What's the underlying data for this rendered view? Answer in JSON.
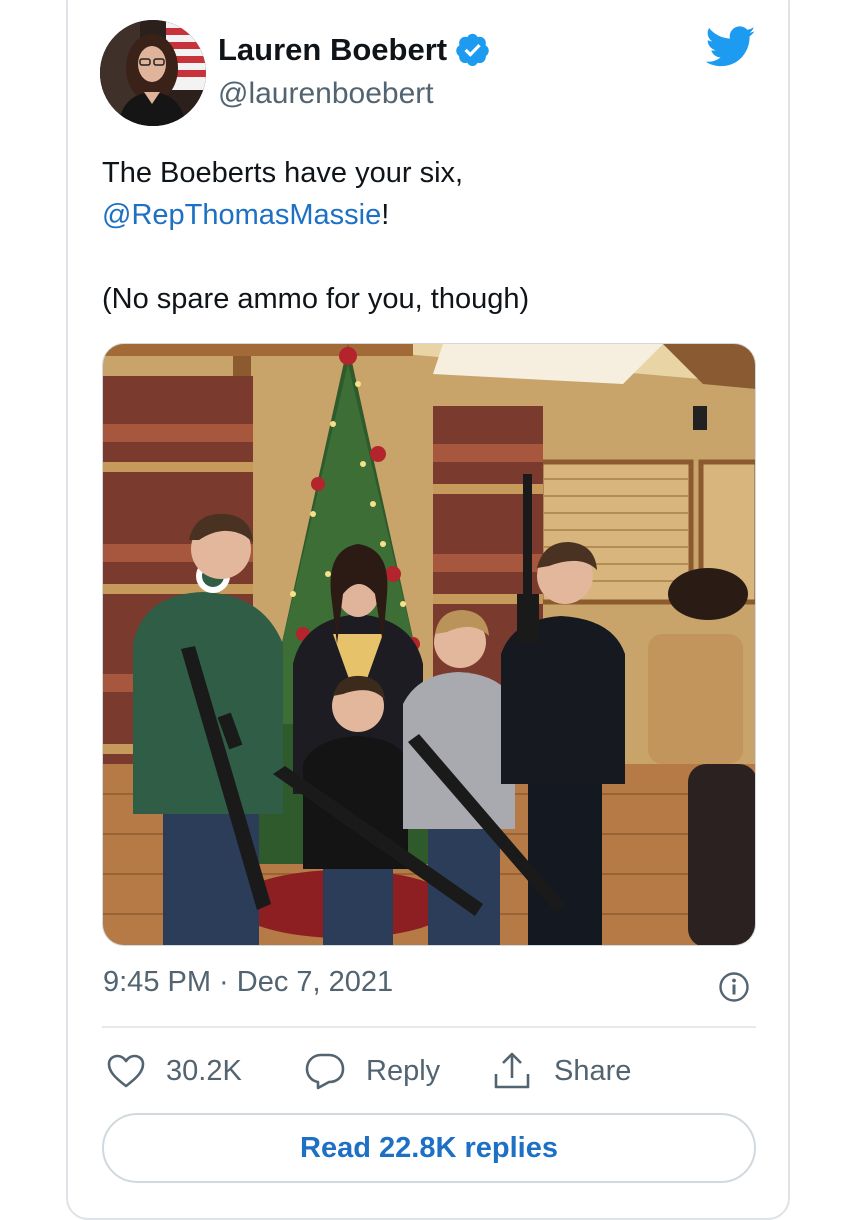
{
  "author": {
    "name": "Lauren Boebert",
    "handle": "@laurenboebert"
  },
  "tweet": {
    "line1": "The Boeberts have your six,",
    "mention": "@RepThomasMassie",
    "mention_suffix": "!",
    "line3": "(No spare ammo for you, though)"
  },
  "timestamp": "9:45 PM · Dec 7, 2021",
  "actions": {
    "likes": "30.2K",
    "reply_label": "Reply",
    "share_label": "Share"
  },
  "read_replies_label": "Read 22.8K replies",
  "colors": {
    "accent": "#1d70c4",
    "twitter_blue": "#1d9bf0",
    "muted_text": "#536471"
  },
  "icons": [
    "verified-badge-icon",
    "twitter-bird-icon",
    "info-icon",
    "heart-icon",
    "reply-bubble-icon",
    "share-icon"
  ]
}
